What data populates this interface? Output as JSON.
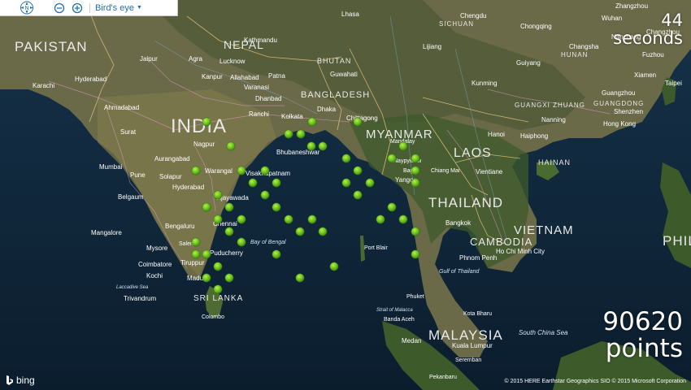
{
  "toolbar": {
    "compass_label": "N",
    "map_mode": "Bird's eye"
  },
  "hud": {
    "time_value": "44",
    "time_unit": "seconds",
    "points_value": "90620",
    "points_unit": "points"
  },
  "attribution": {
    "logo": "bing",
    "copyright": "© 2015 HERE    Earthstar Geographics SIO    © 2015 Microsoft Corporation"
  },
  "map_labels": {
    "countries": [
      "PAKISTAN",
      "NEPAL",
      "INDIA",
      "BANGLADESH",
      "BHUTAN",
      "MYANMAR",
      "LAOS",
      "THAILAND",
      "CAMBODIA",
      "VIETNAM",
      "MALAYSIA",
      "SRI LANKA",
      "PHIL",
      "HAINAN",
      "SICHUAN",
      "HUNAN",
      "GUANGXI ZHUANG",
      "GUANGDONG"
    ],
    "cities": [
      "Karachi",
      "Hyderabad",
      "Ahmadabad",
      "Surat",
      "Mumbai",
      "Pune",
      "Nagpur",
      "Aurangabad",
      "Solapur",
      "Hyderabad",
      "Belgaum",
      "Mangalore",
      "Bengaluru",
      "Chennai",
      "Coimbatore",
      "Kochi",
      "Madurai",
      "Trivandrum",
      "Colombo",
      "Jaipur",
      "Agra",
      "Kanpur",
      "Lucknow",
      "Allahabad",
      "Patna",
      "Varanasi",
      "Ranchi",
      "Dhanbad",
      "Kolkata",
      "Dhaka",
      "Chittagong",
      "Kathmandu",
      "Bhubaneshwar",
      "Visakhapatnam",
      "Vijayawada",
      "Warangal",
      "Puducherry",
      "Salem",
      "Tiruppur",
      "Mysore",
      "Guwahati",
      "Mandalay",
      "Naypyidaw",
      "Yangon",
      "Bago",
      "Chiang Mai",
      "Vientiane",
      "Bangkok",
      "Phnom Penh",
      "Ho Chi Minh City",
      "Hanoi",
      "Haiphong",
      "Nanning",
      "Guangzhou",
      "Shenzhen",
      "Hong Kong",
      "Kunming",
      "Guiyang",
      "Chongqing",
      "Chengdu",
      "Changsha",
      "Wuhan",
      "Nanchang",
      "Fuzhou",
      "Xiamen",
      "Taipei",
      "Kota Bharu",
      "Kuala Lumpur",
      "Medan",
      "Banda Aceh",
      "Phuket",
      "Port Blair",
      "Seremban",
      "Pekanbaru",
      "Lhasa",
      "Lijiang",
      "Zhangzhou",
      "Changzhou"
    ],
    "waters": [
      "Bay of Bengal",
      "Gulf of Thailand",
      "South China Sea",
      "Strait of Malacca",
      "Laccadive Sea"
    ]
  },
  "points": {
    "color": "#6abf1f",
    "count_shown": 52
  }
}
